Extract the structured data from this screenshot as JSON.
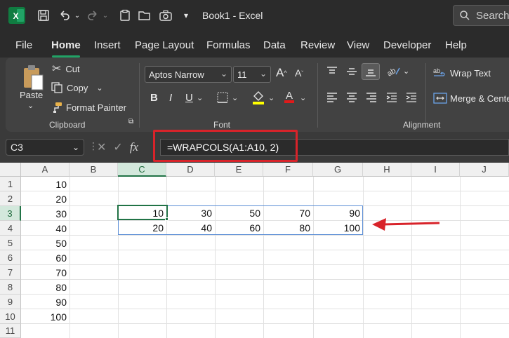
{
  "titlebar": {
    "book_title": "Book1  -  Excel",
    "search_label": "Search"
  },
  "menu": {
    "items": [
      {
        "label": "File"
      },
      {
        "label": "Home"
      },
      {
        "label": "Insert"
      },
      {
        "label": "Page Layout"
      },
      {
        "label": "Formulas"
      },
      {
        "label": "Data"
      },
      {
        "label": "Review"
      },
      {
        "label": "View"
      },
      {
        "label": "Developer"
      },
      {
        "label": "Help"
      }
    ],
    "active": "Home"
  },
  "ribbon": {
    "clipboard": {
      "paste": "Paste",
      "cut": "Cut",
      "copy": "Copy",
      "format_painter": "Format Painter",
      "label": "Clipboard"
    },
    "font": {
      "name": "Aptos Narrow",
      "size": "11",
      "bold": "B",
      "italic": "I",
      "underline": "U",
      "label": "Font"
    },
    "alignment": {
      "wrap_text": "Wrap Text",
      "merge_center": "Merge & Center",
      "label": "Alignment"
    }
  },
  "formula_bar": {
    "name_box": "C3",
    "formula": "=WRAPCOLS(A1:A10, 2)"
  },
  "sheet": {
    "columns": [
      "A",
      "B",
      "C",
      "D",
      "E",
      "F",
      "G",
      "H",
      "I",
      "J"
    ],
    "rows": [
      "1",
      "2",
      "3",
      "4",
      "5",
      "6",
      "7",
      "8",
      "9",
      "10",
      "11"
    ],
    "col_a_values": [
      "10",
      "20",
      "30",
      "40",
      "50",
      "60",
      "70",
      "80",
      "90",
      "100"
    ],
    "spill_row3": [
      "10",
      "30",
      "50",
      "70",
      "90"
    ],
    "spill_row4": [
      "20",
      "40",
      "60",
      "80",
      "100"
    ]
  },
  "colors": {
    "accent": "#217346",
    "highlight": "#d8232a",
    "spill": "#5b8ed6"
  }
}
